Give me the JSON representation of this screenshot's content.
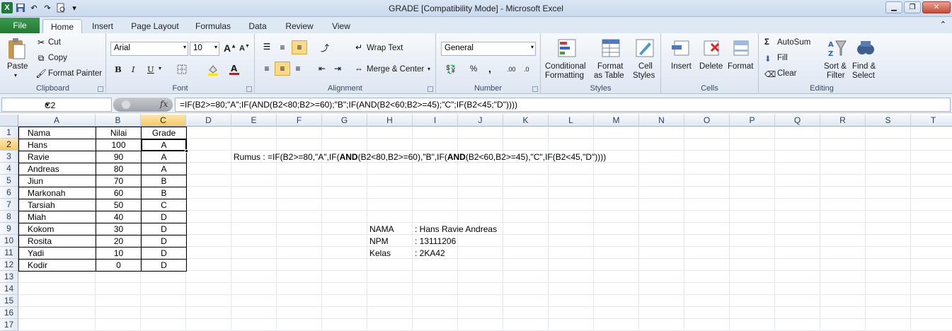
{
  "window": {
    "title": "GRADE  [Compatibility Mode]  -  Microsoft Excel",
    "qat": [
      "excel-icon",
      "save-icon",
      "undo-icon",
      "redo-icon",
      "print-preview-icon",
      "customize-icon"
    ]
  },
  "tabs": [
    "File",
    "Home",
    "Insert",
    "Page Layout",
    "Formulas",
    "Data",
    "Review",
    "View"
  ],
  "ribbon": {
    "clipboard": {
      "label": "Clipboard",
      "paste": "Paste",
      "cut": "Cut",
      "copy": "Copy",
      "format_painter": "Format Painter"
    },
    "font": {
      "label": "Font",
      "font_name": "Arial",
      "font_size": "10",
      "bold": "B",
      "italic": "I",
      "underline": "U"
    },
    "alignment": {
      "label": "Alignment",
      "wrap_text": "Wrap Text",
      "merge_center": "Merge & Center"
    },
    "number": {
      "label": "Number",
      "format": "General",
      "percent": "%",
      "comma": ",",
      "inc_decimal": ".00",
      "dec_decimal": ".0"
    },
    "styles": {
      "label": "Styles",
      "conditional_1": "Conditional",
      "conditional_2": "Formatting",
      "format_table_1": "Format",
      "format_table_2": "as Table",
      "cell_styles_1": "Cell",
      "cell_styles_2": "Styles"
    },
    "cells": {
      "label": "Cells",
      "insert": "Insert",
      "delete": "Delete",
      "format": "Format"
    },
    "editing": {
      "label": "Editing",
      "autosum": "AutoSum",
      "fill": "Fill",
      "clear": "Clear",
      "sort_1": "Sort &",
      "sort_2": "Filter",
      "find_1": "Find &",
      "find_2": "Select"
    }
  },
  "formula_bar": {
    "name_box": "C2",
    "fx": "fx",
    "formula": "=IF(B2>=80;\"A\";IF(AND(B2<80;B2>=60);\"B\";IF(AND(B2<60;B2>=45);\"C\";IF(B2<45;\"D\"))))"
  },
  "columns": [
    "A",
    "B",
    "C",
    "D",
    "E",
    "F",
    "G",
    "H",
    "I",
    "J",
    "K",
    "L",
    "M",
    "N",
    "O",
    "P",
    "Q",
    "R",
    "S",
    "T"
  ],
  "rows": [
    "1",
    "2",
    "3",
    "4",
    "5",
    "6",
    "7",
    "8",
    "9",
    "10",
    "11",
    "12",
    "13",
    "14",
    "15",
    "16",
    "17"
  ],
  "table": {
    "headers": [
      "Nama",
      "Nilai",
      "Grade"
    ],
    "data": [
      [
        "Hans",
        "100",
        "A"
      ],
      [
        "Ravie",
        "90",
        "A"
      ],
      [
        "Andreas",
        "80",
        "A"
      ],
      [
        "Jiun",
        "70",
        "B"
      ],
      [
        "Markonah",
        "60",
        "B"
      ],
      [
        "Tarsiah",
        "50",
        "C"
      ],
      [
        "Miah",
        "40",
        "D"
      ],
      [
        "Kokom",
        "30",
        "D"
      ],
      [
        "Rosita",
        "20",
        "D"
      ],
      [
        "Yadi",
        "10",
        "D"
      ],
      [
        "Kodir",
        "0",
        "D"
      ]
    ]
  },
  "rumus": {
    "p1": "Rumus : =IF(B2>=80,\"A\",IF(",
    "b1": "AND",
    "p2": "(B2<80,B2>=60),\"B\",IF(",
    "b2": "AND",
    "p3": "(B2<60,B2>=45),\"C\",IF(B2<45,\"D\"))))"
  },
  "info": [
    {
      "key": "NAMA",
      "value": ": Hans Ravie Andreas"
    },
    {
      "key": "NPM",
      "value": ": 13111206"
    },
    {
      "key": "Kelas",
      "value": ": 2KA42"
    }
  ]
}
